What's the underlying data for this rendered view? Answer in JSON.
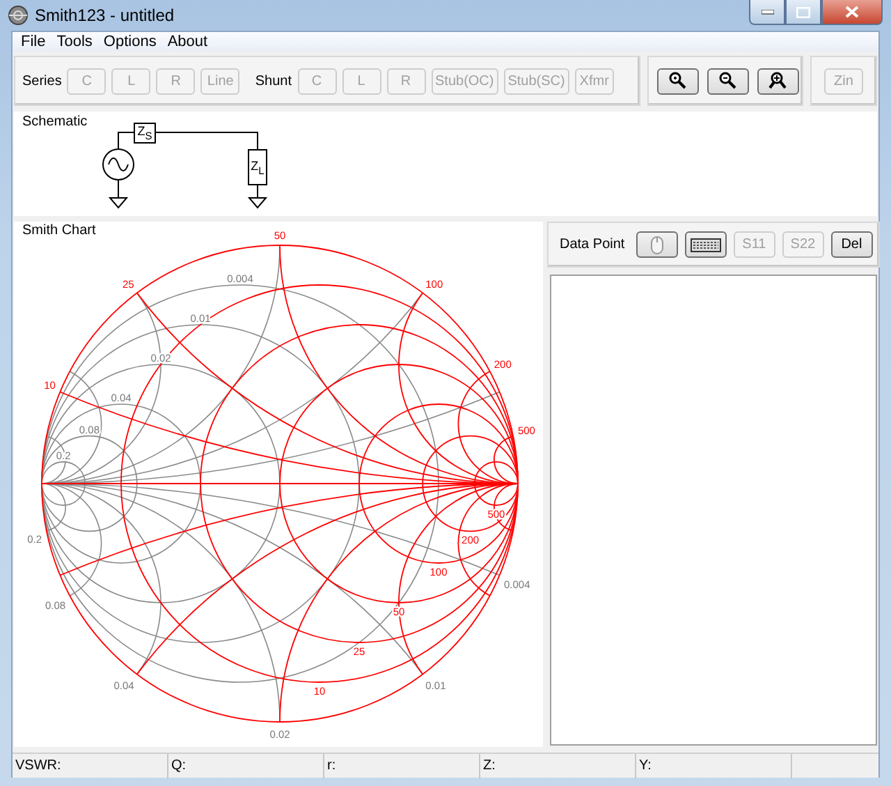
{
  "window": {
    "title": "Smith123 - untitled"
  },
  "menu": [
    "File",
    "Tools",
    "Options",
    "About"
  ],
  "toolbar": {
    "series_label": "Series",
    "series_buttons": [
      {
        "label": "C",
        "disabled": true
      },
      {
        "label": "L",
        "disabled": true
      },
      {
        "label": "R",
        "disabled": true
      },
      {
        "label": "Line",
        "disabled": true
      }
    ],
    "shunt_label": "Shunt",
    "shunt_buttons": [
      {
        "label": "C",
        "disabled": true
      },
      {
        "label": "L",
        "disabled": true
      },
      {
        "label": "R",
        "disabled": true
      },
      {
        "label": "Stub(OC)",
        "disabled": true
      },
      {
        "label": "Stub(SC)",
        "disabled": true
      },
      {
        "label": "Xfmr",
        "disabled": true
      }
    ],
    "zin_button": {
      "label": "Zin",
      "disabled": true
    }
  },
  "schematic": {
    "title": "Schematic",
    "source_impedance": "Z$_{S}$",
    "load_impedance": "Z$_{L}$"
  },
  "smith_chart": {
    "title": "Smith Chart",
    "reactance_labels": [
      "10",
      "25",
      "50",
      "100",
      "200",
      "500"
    ],
    "resistance_labels": [
      "10",
      "25",
      "50",
      "100",
      "200",
      "500"
    ],
    "conductance_labels": [
      "0.004",
      "0.01",
      "0.02",
      "0.04",
      "0.08",
      "0.2"
    ],
    "susceptance_labels": [
      "0.004",
      "0.01",
      "0.02",
      "0.04",
      "0.08",
      "0.2"
    ]
  },
  "data_point": {
    "label": "Data Point",
    "buttons": [
      {
        "label": "S11",
        "disabled": true
      },
      {
        "label": "S22",
        "disabled": true
      },
      {
        "label": "Del",
        "disabled": false
      }
    ]
  },
  "status_bar": [
    "VSWR:",
    "Q:",
    "r:",
    "Z:",
    "Y:"
  ]
}
